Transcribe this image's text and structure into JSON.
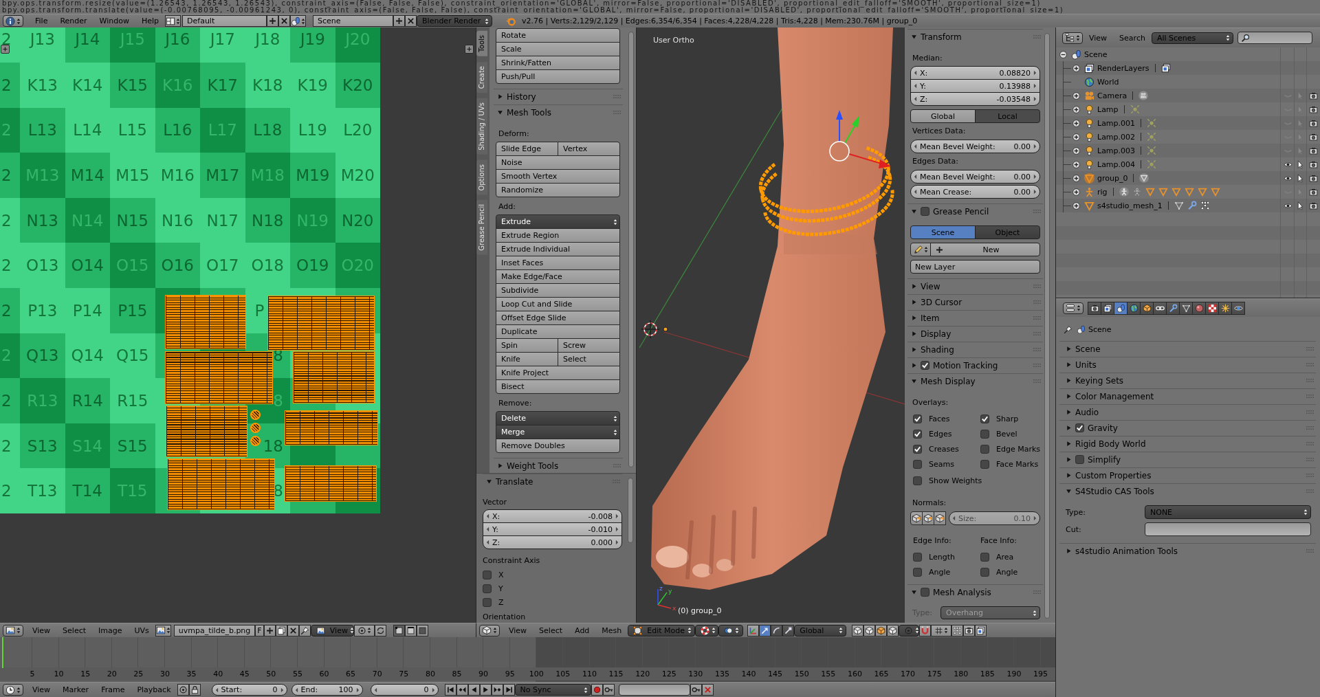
{
  "console_log": [
    "bpy.ops.transform.resize(value=(1.26543, 1.26543, 1.26543), constraint_axis=(False, False, False), constraint_orientation='GLOBAL', mirror=False, proportional='DISABLED', proportional_edit_falloff='SMOOTH', proportional_size=1)",
    "bpy.ops.transform.translate(value=(-0.00768095, -0.00961243, 0), constraint_axis=(False, False, False), constraint_orientation='GLOBAL', mirror=False, proportional='DISABLED', proportional_edit_falloff='SMOOTH', proportional_size=1)"
  ],
  "info_header": {
    "menus": [
      "File",
      "Render",
      "Window",
      "Help"
    ],
    "screen_layout": "Default",
    "scene": "Scene",
    "render_engine": "Blender Render",
    "stats": "v2.76 | Verts:2,129/2,129 | Edges:6,354/6,354 | Faces:4,228/4,228 | Tris:4,228 | Mem:230.76M | group_0"
  },
  "uv_editor": {
    "texture_rows": [
      [
        "2",
        "J13",
        "J14",
        "J15",
        "J16",
        "J17",
        "J18",
        "J19",
        "J20"
      ],
      [
        "2",
        "K13",
        "K14",
        "K15",
        "K16",
        "K17",
        "K18",
        "K19",
        "K20"
      ],
      [
        "2",
        "L13",
        "L14",
        "L15",
        "L16",
        "L17",
        "L18",
        "L19",
        "L20"
      ],
      [
        "2",
        "M13",
        "M14",
        "M15",
        "M16",
        "M17",
        "M18",
        "M19",
        "M20"
      ],
      [
        "2",
        "N13",
        "N14",
        "N15",
        "N16",
        "N17",
        "N18",
        "N19",
        "N20"
      ],
      [
        "2",
        "O13",
        "O14",
        "O15",
        "O16",
        "O17",
        "O18",
        "O19",
        "O20"
      ],
      [
        "2",
        "P13",
        "P14",
        "P15",
        null,
        null,
        {
          "label": "P",
          "kind": "head"
        },
        null,
        null
      ],
      [
        "2",
        "Q13",
        "Q14",
        "Q15",
        null,
        null,
        {
          "label": "8",
          "kind": "tail"
        },
        null,
        null
      ],
      [
        "2",
        "R13",
        "R14",
        "R15",
        null,
        null,
        {
          "label": "8",
          "kind": "tail"
        },
        null,
        null
      ],
      [
        "2",
        "S13",
        "S14",
        "S15",
        null,
        null,
        {
          "label": "18",
          "kind": "tail"
        },
        null,
        null
      ],
      [
        "2",
        "T13",
        "T14",
        "T15",
        null,
        null,
        {
          "label": "8",
          "kind": "tail"
        },
        null,
        null
      ]
    ],
    "header": {
      "menus": [
        "View",
        "Select",
        "Image",
        "UVs"
      ],
      "image_name": "uvmpa_tilde_b.png",
      "fake_user": "F",
      "view_mode": "View"
    }
  },
  "tool_shelf": {
    "tabs": [
      {
        "label": "Tools",
        "selected": true
      },
      {
        "label": "Create",
        "selected": false
      },
      {
        "label": "Shading / UVs",
        "selected": false
      },
      {
        "label": "Options",
        "selected": false
      },
      {
        "label": "Grease Pencil",
        "selected": false
      }
    ],
    "transform_buttons": [
      "Rotate",
      "Scale",
      "Shrink/Fatten",
      "Push/Pull"
    ],
    "panels": [
      {
        "title": "History",
        "expanded": false
      },
      {
        "title": "Mesh Tools",
        "expanded": true,
        "sections": [
          {
            "heading": "Deform:",
            "rows": [
              {
                "kind": "button",
                "buttons": [
                  "Slide Edge",
                  "Vertex"
                ]
              },
              {
                "kind": "button",
                "buttons": [
                  "Noise"
                ]
              },
              {
                "kind": "button",
                "buttons": [
                  "Smooth Vertex"
                ]
              },
              {
                "kind": "button",
                "buttons": [
                  "Randomize"
                ]
              }
            ]
          },
          {
            "heading": "Add:",
            "rows": [
              {
                "kind": "menu",
                "buttons": [
                  "Extrude"
                ]
              },
              {
                "kind": "button",
                "buttons": [
                  "Extrude Region"
                ]
              },
              {
                "kind": "button",
                "buttons": [
                  "Extrude Individual"
                ]
              },
              {
                "kind": "button",
                "buttons": [
                  "Inset Faces"
                ]
              },
              {
                "kind": "button",
                "buttons": [
                  "Make Edge/Face"
                ]
              },
              {
                "kind": "button",
                "buttons": [
                  "Subdivide"
                ]
              },
              {
                "kind": "button",
                "buttons": [
                  "Loop Cut and Slide"
                ]
              },
              {
                "kind": "button",
                "buttons": [
                  "Offset Edge Slide"
                ]
              },
              {
                "kind": "button",
                "buttons": [
                  "Duplicate"
                ]
              },
              {
                "kind": "button",
                "buttons": [
                  "Spin",
                  "Screw"
                ]
              },
              {
                "kind": "button",
                "buttons": [
                  "Knife",
                  "Select"
                ]
              },
              {
                "kind": "button",
                "buttons": [
                  "Knife Project"
                ]
              },
              {
                "kind": "button",
                "buttons": [
                  "Bisect"
                ]
              }
            ]
          },
          {
            "heading": "Remove:",
            "rows": [
              {
                "kind": "menu",
                "buttons": [
                  "Delete"
                ]
              },
              {
                "kind": "menu",
                "buttons": [
                  "Merge"
                ]
              },
              {
                "kind": "button",
                "buttons": [
                  "Remove Doubles"
                ]
              }
            ]
          }
        ]
      },
      {
        "title": "Weight Tools",
        "expanded": false
      }
    ]
  },
  "operator_panel": {
    "title": "Translate",
    "expanded": true,
    "vector_label": "Vector",
    "vector": [
      {
        "axis": "X:",
        "value": "-0.008"
      },
      {
        "axis": "Y:",
        "value": "-0.010"
      },
      {
        "axis": "Z:",
        "value": "0.000"
      }
    ],
    "constraint_label": "Constraint Axis",
    "constraints": [
      {
        "label": "X",
        "checked": false
      },
      {
        "label": "Y",
        "checked": false
      },
      {
        "label": "Z",
        "checked": false
      }
    ],
    "orientation_label": "Orientation"
  },
  "viewport": {
    "view_name": "User Ortho",
    "object_info": "(0) group_0",
    "axis_labels": [
      "z",
      "y",
      "x"
    ],
    "header": {
      "menus": [
        "View",
        "Select",
        "Add",
        "Mesh"
      ],
      "mode": "Edit Mode",
      "manipulators": [
        {
          "kind": "translate",
          "selected": true
        },
        {
          "kind": "rotate",
          "selected": false
        },
        {
          "kind": "scale",
          "selected": false
        }
      ],
      "orientation": "Global"
    }
  },
  "properties_region": {
    "transform": {
      "title": "Transform",
      "expanded": true,
      "median_label": "Median:",
      "median": [
        {
          "axis": "X:",
          "value": "0.08820"
        },
        {
          "axis": "Y:",
          "value": "0.13988"
        },
        {
          "axis": "Z:",
          "value": "-0.03548"
        }
      ],
      "space": [
        {
          "label": "Global",
          "selected": false
        },
        {
          "label": "Local",
          "selected": true
        }
      ],
      "vertices_label": "Vertices Data:",
      "vertex_fields": [
        {
          "label": "Mean Bevel Weight:",
          "value": "0.00"
        }
      ],
      "edges_label": "Edges Data:",
      "edge_fields": [
        {
          "label": "Mean Bevel Weight:",
          "value": "0.00"
        },
        {
          "label": "Mean Crease:",
          "value": "0.00"
        }
      ]
    },
    "grease_pencil": {
      "title": "Grease Pencil",
      "checked": false,
      "expanded": true,
      "source": [
        {
          "label": "Scene",
          "selected": true
        },
        {
          "label": "Object",
          "selected": false
        }
      ],
      "new_button": "New",
      "new_layer_button": "New Layer"
    },
    "collapsed_panels": [
      {
        "title": "View",
        "kind": "plain",
        "expanded": false
      },
      {
        "title": "3D Cursor",
        "kind": "plain",
        "expanded": false
      },
      {
        "title": "Item",
        "kind": "plain",
        "expanded": false
      },
      {
        "title": "Display",
        "kind": "plain",
        "expanded": false
      },
      {
        "title": "Shading",
        "kind": "plain",
        "expanded": false
      },
      {
        "title": "Motion Tracking",
        "kind": "toggle",
        "checked": true,
        "expanded": false
      }
    ],
    "mesh_display": {
      "title": "Mesh Display",
      "expanded": true,
      "overlays_label": "Overlays:",
      "overlays": [
        {
          "label": "Faces",
          "checked": true
        },
        {
          "label": "Sharp",
          "checked": true
        },
        {
          "label": "Edges",
          "checked": true
        },
        {
          "label": "Bevel",
          "checked": false
        },
        {
          "label": "Creases",
          "checked": true
        },
        {
          "label": "Edge Marks",
          "checked": false
        },
        {
          "label": "Seams",
          "checked": false
        },
        {
          "label": "Face Marks",
          "checked": false
        }
      ],
      "show_weights": {
        "label": "Show Weights",
        "checked": false
      },
      "normals_label": "Normals:",
      "normal_size": {
        "label": "Size:",
        "value": "0.10",
        "disabled": true
      },
      "edge_info_label": "Edge Info:",
      "edge_info": [
        {
          "label": "Length",
          "checked": false
        },
        {
          "label": "Angle",
          "checked": false
        }
      ],
      "face_info_label": "Face Info:",
      "face_info": [
        {
          "label": "Area",
          "checked": false
        },
        {
          "label": "Angle",
          "checked": false
        }
      ]
    },
    "mesh_analysis": {
      "title": "Mesh Analysis",
      "checked": false,
      "expanded": true,
      "type_label": "Type:",
      "type_value": "Overhang",
      "disabled": true
    }
  },
  "outliner": {
    "header": {
      "menus": [
        "View",
        "Search"
      ],
      "display_mode": "All Scenes"
    },
    "tree": [
      {
        "name": "Scene",
        "kind": "scene",
        "expanded": true,
        "selected": false,
        "children": [
          {
            "name": "RenderLayers",
            "kind": "renderlayers",
            "expanded": false,
            "selected": false,
            "contents": [
              {
                "kind": "render_layer"
              }
            ]
          },
          {
            "name": "World",
            "kind": "world",
            "selected": false
          },
          {
            "name": "Camera",
            "kind": "camera",
            "expanded": false,
            "selected": false,
            "hidden": true,
            "contents": [
              {
                "kind": "camera_data"
              }
            ]
          },
          {
            "name": "Lamp",
            "kind": "lamp",
            "expanded": false,
            "selected": false,
            "hidden": true,
            "contents": [
              {
                "kind": "lamp_data"
              }
            ]
          },
          {
            "name": "Lamp.001",
            "kind": "lamp",
            "expanded": false,
            "selected": false,
            "hidden": true,
            "contents": [
              {
                "kind": "lamp_data"
              }
            ]
          },
          {
            "name": "Lamp.002",
            "kind": "lamp",
            "expanded": false,
            "selected": false,
            "hidden": true,
            "contents": [
              {
                "kind": "lamp_data"
              }
            ]
          },
          {
            "name": "Lamp.003",
            "kind": "lamp",
            "expanded": false,
            "selected": false,
            "hidden": true,
            "contents": [
              {
                "kind": "lamp_data"
              }
            ]
          },
          {
            "name": "Lamp.004",
            "kind": "lamp",
            "expanded": false,
            "selected": false,
            "hidden": false,
            "contents": [
              {
                "kind": "lamp_data"
              }
            ]
          },
          {
            "name": "group_0",
            "kind": "mesh",
            "expanded": false,
            "selected": true,
            "hidden": false,
            "contents": [
              {
                "kind": "mesh_data"
              }
            ]
          },
          {
            "name": "rig",
            "kind": "armature",
            "expanded": false,
            "selected": false,
            "hidden": true,
            "contents": [
              {
                "kind": "pose"
              },
              {
                "kind": "bones"
              },
              {
                "kind": "mesh"
              },
              {
                "kind": "mesh"
              },
              {
                "kind": "mesh"
              },
              {
                "kind": "mesh"
              },
              {
                "kind": "mesh"
              },
              {
                "kind": "mesh"
              }
            ]
          },
          {
            "name": "s4studio_mesh_1",
            "kind": "mesh",
            "expanded": false,
            "selected": false,
            "hidden": false,
            "contents": [
              {
                "kind": "mesh_outline"
              },
              {
                "kind": "modifier"
              },
              {
                "kind": "vertex_groups"
              }
            ]
          }
        ]
      }
    ]
  },
  "properties": {
    "context_tabs": [
      {
        "kind": "render",
        "selected": false
      },
      {
        "kind": "layers",
        "selected": false
      },
      {
        "kind": "scene",
        "selected": true
      },
      {
        "kind": "world",
        "selected": false
      },
      {
        "kind": "object",
        "selected": false
      },
      {
        "kind": "constraints",
        "selected": false
      },
      {
        "kind": "modifiers",
        "selected": false
      },
      {
        "kind": "data",
        "selected": false
      },
      {
        "kind": "material",
        "selected": false
      },
      {
        "kind": "texture",
        "selected": false
      },
      {
        "kind": "particles",
        "selected": false
      },
      {
        "kind": "physics",
        "selected": false
      }
    ],
    "breadcrumb": "Scene",
    "panels": [
      {
        "title": "Scene",
        "kind": "plain",
        "expanded": false
      },
      {
        "title": "Units",
        "kind": "plain",
        "expanded": false
      },
      {
        "title": "Keying Sets",
        "kind": "plain",
        "expanded": false
      },
      {
        "title": "Color Management",
        "kind": "plain",
        "expanded": false
      },
      {
        "title": "Audio",
        "kind": "plain",
        "expanded": false
      },
      {
        "title": "Gravity",
        "kind": "toggle",
        "checked": true,
        "expanded": false
      },
      {
        "title": "Rigid Body World",
        "kind": "plain",
        "expanded": false
      },
      {
        "title": "Simplify",
        "kind": "toggle",
        "checked": false,
        "expanded": false
      },
      {
        "title": "Custom Properties",
        "kind": "plain",
        "expanded": false
      },
      {
        "title": "S4Studio CAS Tools",
        "kind": "plain",
        "expanded": true,
        "fields": [
          {
            "label": "Type:",
            "kind": "menu",
            "value": "NONE"
          },
          {
            "label": "Cut:",
            "kind": "text"
          }
        ]
      },
      {
        "title": "s4studio Animation Tools",
        "kind": "plain",
        "expanded": false
      }
    ]
  },
  "timeline": {
    "frame_numbers": [
      "5",
      "10",
      "15",
      "20",
      "25",
      "30",
      "35",
      "40",
      "45",
      "50",
      "55",
      "60",
      "65",
      "70",
      "75",
      "80",
      "85",
      "90",
      "95",
      "100",
      "105",
      "110",
      "115",
      "120",
      "125",
      "130",
      "135",
      "140",
      "145",
      "150",
      "155",
      "160",
      "165",
      "170",
      "175",
      "180",
      "185",
      "190",
      "195"
    ],
    "header": {
      "menus": [
        "View",
        "Marker",
        "Frame",
        "Playback"
      ],
      "start": {
        "label": "Start:",
        "value": "0"
      },
      "end": {
        "label": "End:",
        "value": "100"
      },
      "current_frame": "0",
      "sync": "No Sync"
    }
  }
}
